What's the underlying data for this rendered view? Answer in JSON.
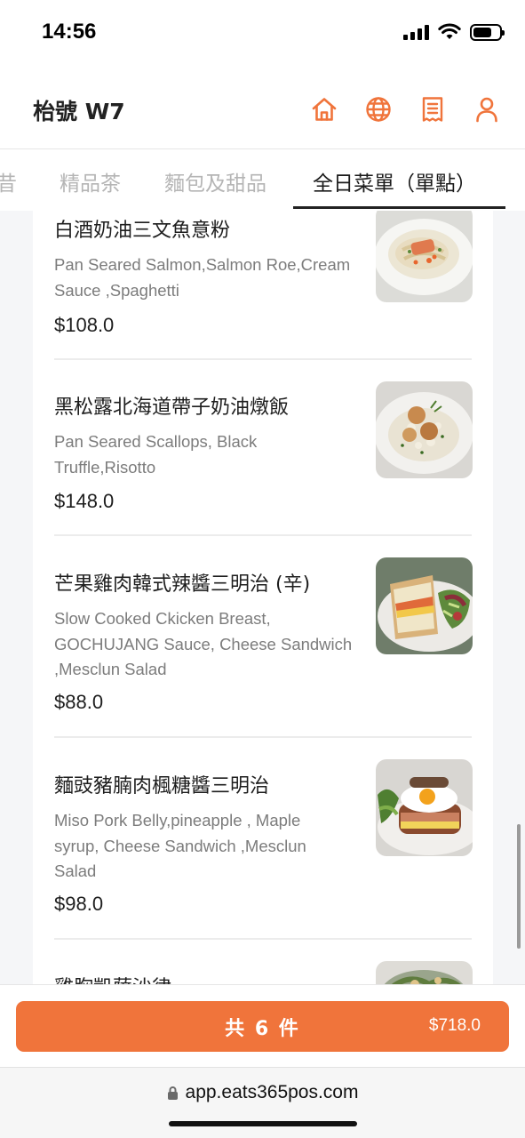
{
  "status_bar": {
    "time": "14:56"
  },
  "header": {
    "store_name": "枱號 W7",
    "icons": [
      "home-icon",
      "globe-icon",
      "receipt-icon",
      "user-icon"
    ],
    "accent_color": "#f0743b"
  },
  "tabs": {
    "items": [
      {
        "label": "昔",
        "active": false
      },
      {
        "label": "精品茶",
        "active": false
      },
      {
        "label": "麵包及甜品",
        "active": false
      },
      {
        "label": "全日菜單（單點）",
        "active": true
      }
    ]
  },
  "menu": {
    "items": [
      {
        "name": "白酒奶油三文魚意粉",
        "desc_lines": [
          "Pan Seared Salmon,Salmon Roe,Cream",
          "Sauce ,Spaghetti"
        ],
        "price": "$108.0"
      },
      {
        "name": "黑松露北海道帶子奶油燉飯",
        "desc_lines": [
          "Pan Seared Scallops, Black",
          "Truffle,Risotto"
        ],
        "price": "$148.0"
      },
      {
        "name": "芒果雞肉韓式辣醬三明治 (辛)",
        "desc_lines": [
          "Slow Cooked Ckicken Breast,",
          "GOCHUJANG Sauce, Cheese Sandwich",
          ",Mesclun Salad"
        ],
        "price": "$88.0"
      },
      {
        "name": "麵豉豬腩肉楓糖醬三明治",
        "desc_lines": [
          "Miso Pork Belly,pineapple , Maple",
          "syrup, Cheese Sandwich ,Mesclun",
          "Salad"
        ],
        "price": "$98.0"
      },
      {
        "name": "雞胸凱薩沙律",
        "desc_lines": [],
        "price": ""
      }
    ]
  },
  "cart": {
    "count_label": "共 6 件",
    "total": "$718.0"
  },
  "browser": {
    "url": "app.eats365pos.com"
  }
}
